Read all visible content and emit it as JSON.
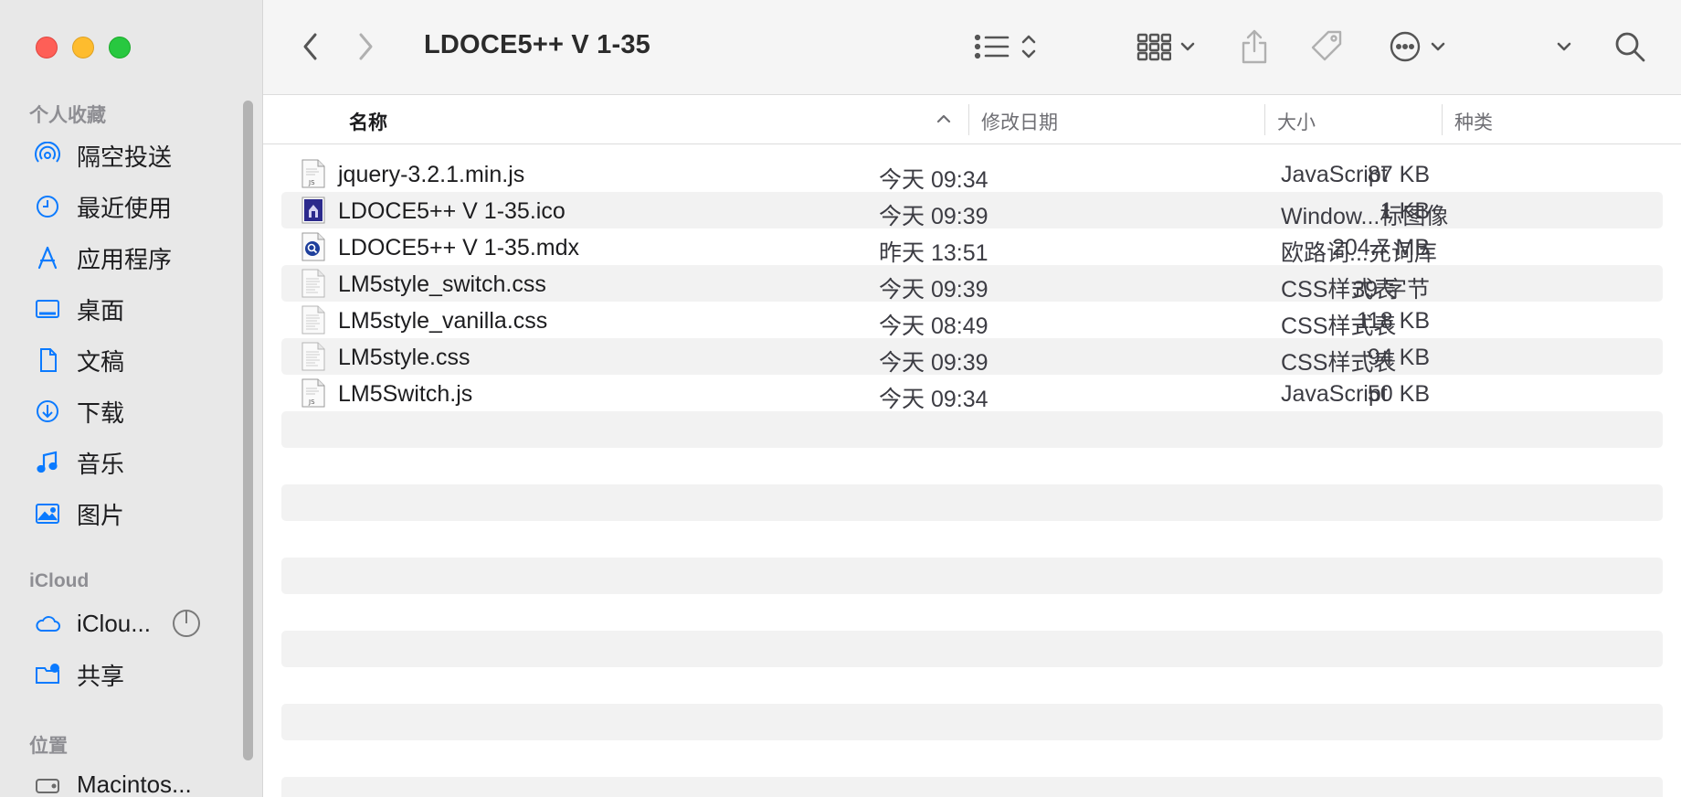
{
  "window": {
    "title": "LDOCE5++ V 1-35"
  },
  "sidebar": {
    "favorites_header": "个人收藏",
    "favorites": [
      {
        "label": "隔空投送",
        "icon": "airdrop-icon"
      },
      {
        "label": "最近使用",
        "icon": "clock-icon"
      },
      {
        "label": "应用程序",
        "icon": "applications-icon"
      },
      {
        "label": "桌面",
        "icon": "desktop-icon"
      },
      {
        "label": "文稿",
        "icon": "document-icon"
      },
      {
        "label": "下载",
        "icon": "download-icon"
      },
      {
        "label": "音乐",
        "icon": "music-icon"
      },
      {
        "label": "图片",
        "icon": "photos-icon"
      }
    ],
    "icloud_header": "iCloud",
    "icloud": [
      {
        "label": "iClou...",
        "icon": "cloud-icon"
      },
      {
        "label": "共享",
        "icon": "shared-folder-icon"
      }
    ],
    "locations_header": "位置",
    "locations": [
      {
        "label": "Macintos...",
        "icon": "disk-icon"
      }
    ]
  },
  "columns": {
    "name": "名称",
    "date": "修改日期",
    "size": "大小",
    "kind": "种类"
  },
  "files": [
    {
      "name": "jquery-3.2.1.min.js",
      "date": "今天 09:34",
      "size": "87 KB",
      "kind": "JavaScript",
      "icon": "js-file-icon"
    },
    {
      "name": "LDOCE5++ V 1-35.ico",
      "date": "今天 09:39",
      "size": "1 KB",
      "kind": "Window...标图像",
      "icon": "ico-file-icon"
    },
    {
      "name": "LDOCE5++ V 1-35.mdx",
      "date": "昨天 13:51",
      "size": "204.7 MB",
      "kind": "欧路词...充词库",
      "icon": "mdx-file-icon"
    },
    {
      "name": "LM5style_switch.css",
      "date": "今天 09:39",
      "size": "39 字节",
      "kind": "CSS样式表",
      "icon": "css-file-icon"
    },
    {
      "name": "LM5style_vanilla.css",
      "date": "今天 08:49",
      "size": "118 KB",
      "kind": "CSS样式表",
      "icon": "css-file-icon"
    },
    {
      "name": "LM5style.css",
      "date": "今天 09:39",
      "size": "94 KB",
      "kind": "CSS样式表",
      "icon": "css-file-icon"
    },
    {
      "name": "LM5Switch.js",
      "date": "今天 09:34",
      "size": "50 KB",
      "kind": "JavaScript",
      "icon": "js-file-icon"
    }
  ],
  "colors": {
    "sidebar_bg": "#e8e8e8",
    "accent": "#0a7aff",
    "row_alt": "#f2f2f2"
  }
}
